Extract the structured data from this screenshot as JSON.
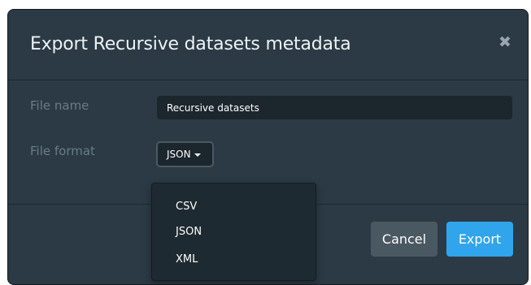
{
  "dialog": {
    "title": "Export Recursive datasets metadata",
    "close_icon": "close-icon"
  },
  "form": {
    "file_name_label": "File name",
    "file_name_value": "Recursive datasets",
    "file_format_label": "File format",
    "file_format_selected": "JSON",
    "file_format_options": [
      "CSV",
      "JSON",
      "XML"
    ]
  },
  "footer": {
    "cancel_label": "Cancel",
    "export_label": "Export"
  },
  "colors": {
    "dialog_bg": "#2b3a44",
    "input_bg": "#1b262d",
    "accent": "#30a5eb",
    "secondary_button": "#4a5862",
    "label_text": "#6b7c86"
  }
}
